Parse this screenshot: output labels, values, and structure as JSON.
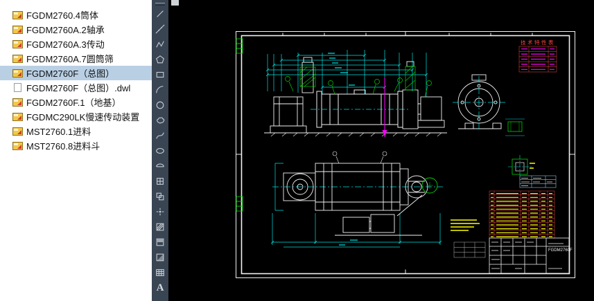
{
  "file_panel": {
    "selection_color": "#b9cfe4",
    "items": [
      {
        "label": "FGDM2760.4筒体",
        "icon": "dwg-file-icon",
        "selected": false
      },
      {
        "label": "FGDM2760A.2轴承",
        "icon": "dwg-file-icon",
        "selected": false
      },
      {
        "label": "FGDM2760A.3传动",
        "icon": "dwg-file-icon",
        "selected": false
      },
      {
        "label": "FGDM2760A.7圆筒筛",
        "icon": "dwg-file-icon",
        "selected": false
      },
      {
        "label": "FGDM2760F（总图）",
        "icon": "dwg-file-icon",
        "selected": true
      },
      {
        "label": "FGDM2760F（总图）.dwl",
        "icon": "plain-file-icon",
        "selected": false
      },
      {
        "label": "FGDM2760F.1（地基）",
        "icon": "dwg-file-icon",
        "selected": false
      },
      {
        "label": "FGDMC290LK慢速传动装置",
        "icon": "dwg-file-icon",
        "selected": false
      },
      {
        "label": "MST2760.1进料",
        "icon": "dwg-file-icon",
        "selected": false
      },
      {
        "label": "MST2760.8进料斗",
        "icon": "dwg-file-icon",
        "selected": false
      }
    ]
  },
  "toolbar": {
    "tools": [
      {
        "id": "line",
        "label": "Line"
      },
      {
        "id": "construction-line",
        "label": "Construction Line"
      },
      {
        "id": "polyline",
        "label": "Polyline"
      },
      {
        "id": "polygon",
        "label": "Polygon"
      },
      {
        "id": "rectangle",
        "label": "Rectangle"
      },
      {
        "id": "arc",
        "label": "Arc"
      },
      {
        "id": "circle",
        "label": "Circle"
      },
      {
        "id": "revision-cloud",
        "label": "Revision Cloud"
      },
      {
        "id": "spline",
        "label": "Spline"
      },
      {
        "id": "ellipse",
        "label": "Ellipse"
      },
      {
        "id": "ellipse-arc",
        "label": "Ellipse Arc"
      },
      {
        "id": "insert-block",
        "label": "Insert Block"
      },
      {
        "id": "make-block",
        "label": "Make Block"
      },
      {
        "id": "point",
        "label": "Point"
      },
      {
        "id": "hatch",
        "label": "Hatch"
      },
      {
        "id": "gradient",
        "label": "Gradient"
      },
      {
        "id": "region",
        "label": "Region"
      },
      {
        "id": "table",
        "label": "Table"
      },
      {
        "id": "mtext",
        "label": "Multiline Text",
        "glyph": "A"
      }
    ]
  },
  "canvas": {
    "drawing": {
      "spec_table_title": "技术特性表",
      "title_block_number": "FGDM2760F"
    },
    "colors": {
      "background": "#000000",
      "geometry": "#f2f2f2",
      "dimension": "#00e0e0",
      "hatch_green": "#00d200",
      "annotation_yellow": "#ffff00",
      "table_red": "#cc3b3b",
      "section_magenta": "#ff00ff",
      "title_red": "#ff4444"
    }
  }
}
